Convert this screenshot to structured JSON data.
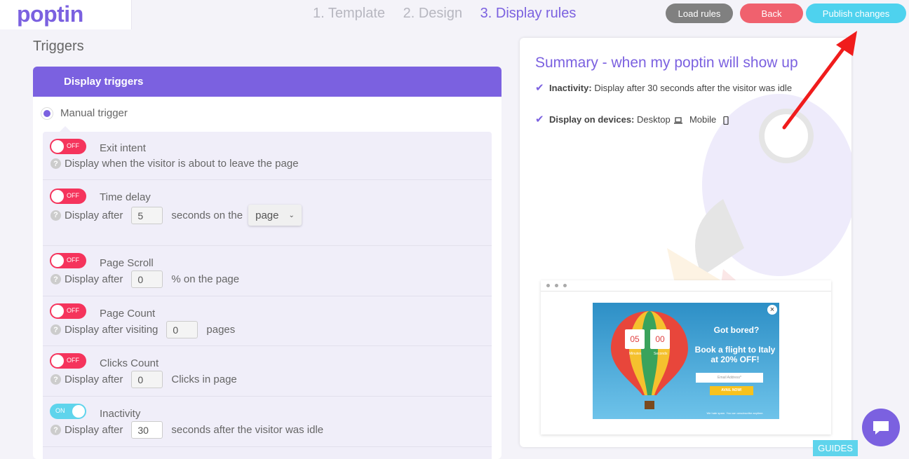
{
  "header": {
    "logo": "poptin",
    "steps": [
      "1. Template",
      "2. Design",
      "3. Display rules"
    ],
    "active_step": 2,
    "load_rules": "Load rules",
    "back": "Back",
    "publish": "Publish changes"
  },
  "triggers": {
    "title": "Triggers",
    "panel_title": "Display triggers",
    "manual_trigger": "Manual trigger",
    "rows": [
      {
        "toggle": "OFF",
        "title": "Exit intent",
        "desc": "Display when the visitor is about to leave the page"
      },
      {
        "toggle": "OFF",
        "title": "Time delay",
        "desc_prefix": "Display after",
        "value": "5",
        "desc_suffix": "seconds on the",
        "select": "page"
      },
      {
        "toggle": "OFF",
        "title": "Page Scroll",
        "desc_prefix": "Display after",
        "value": "0",
        "desc_suffix": "% on the page"
      },
      {
        "toggle": "OFF",
        "title": "Page Count",
        "desc_prefix": "Display after visiting",
        "value": "0",
        "desc_suffix": "pages"
      },
      {
        "toggle": "OFF",
        "title": "Clicks Count",
        "desc_prefix": "Display after",
        "value": "0",
        "desc_suffix": "Clicks in page"
      },
      {
        "toggle": "ON",
        "title": "Inactivity",
        "desc_prefix": "Display after",
        "value": "30",
        "desc_suffix": "seconds after the visitor was idle"
      }
    ]
  },
  "summary": {
    "title": "Summary - when my poptin will show up",
    "item1_label": "Inactivity:",
    "item1_text": "Display after 30 seconds after the visitor was idle",
    "item2_label": "Display on devices:",
    "item2_desktop": "Desktop",
    "item2_mobile": "Mobile"
  },
  "popup": {
    "minutes": "05",
    "seconds": "00",
    "minutes_label": "Minutes",
    "seconds_label": "Seconds",
    "headline": "Got bored?",
    "subline": "Book a flight to Italy at 20% OFF!",
    "email_placeholder": "Email Address*",
    "cta": "AVAIL NOW!",
    "footer": "We hate spam. You can unsubscribe anytime."
  },
  "guides": "GUIDES",
  "colors": {
    "accent": "#7b61e0",
    "off": "#f5345c",
    "on": "#5fd4ec",
    "back": "#f0616e",
    "publish": "#4ed2ee"
  }
}
